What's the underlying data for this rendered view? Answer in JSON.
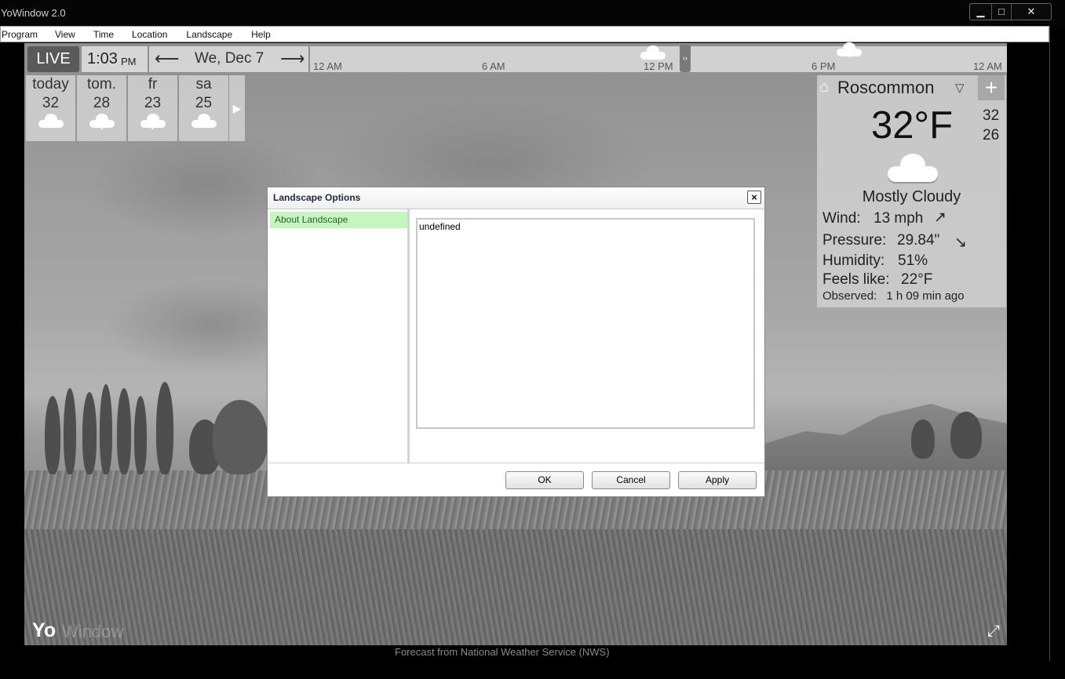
{
  "window": {
    "title": "YoWindow 2.0",
    "minimize": "▁",
    "maximize": "□",
    "close": "✕"
  },
  "menu": [
    "Program",
    "View",
    "Time",
    "Location",
    "Landscape",
    "Help"
  ],
  "timeline": {
    "live": "LIVE",
    "time": "1:03",
    "ampm": "PM",
    "prev_icon": "arrow-left-icon",
    "prev": "⟵",
    "date": "We, Dec 7",
    "next_icon": "arrow-right-icon",
    "next": "⟶",
    "hours": [
      "12 AM",
      "6 AM",
      "12 PM",
      "6 PM",
      "12 AM"
    ],
    "handle": "‹›"
  },
  "forecast": [
    {
      "name": "today",
      "temp": "32",
      "icon": "cloud-icon",
      "snow": ""
    },
    {
      "name": "tom.",
      "temp": "28",
      "icon": "cloud-snow-icon",
      "snow": "*"
    },
    {
      "name": "fr",
      "temp": "23",
      "icon": "cloud-snow-icon",
      "snow": "*"
    },
    {
      "name": "sa",
      "temp": "25",
      "icon": "cloud-icon",
      "snow": ""
    }
  ],
  "forecast_next": "▶",
  "current": {
    "home_icon": "⌂",
    "location": "Roscommon",
    "dropdown": "▽",
    "add": "+",
    "temp": "32°F",
    "hi": "32",
    "lo": "26",
    "condition": "Mostly Cloudy",
    "wind_label": "Wind:",
    "wind_value": "13 mph",
    "wind_arrow": "↗",
    "pressure_label": "Pressure:",
    "pressure_value": "29.84\"",
    "pressure_arrow": "↘",
    "humidity_label": "Humidity:",
    "humidity_value": "51%",
    "feels_label": "Feels like:",
    "feels_value": "22°F",
    "observed_label": "Observed:",
    "observed_value": "1 h 09 min ago"
  },
  "dialog": {
    "title": "Landscape Options",
    "close": "×",
    "side_items": [
      "About Landscape"
    ],
    "content": "undefined",
    "ok": "OK",
    "cancel": "Cancel",
    "apply": "Apply"
  },
  "logo": {
    "yo": "Yo",
    "window": "Window"
  },
  "fullscreen": "⤢",
  "credit": "Forecast from National Weather Service (NWS)"
}
